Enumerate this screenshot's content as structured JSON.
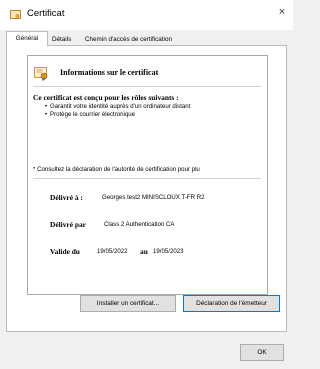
{
  "window": {
    "title": "Certificat",
    "close_glyph": "×"
  },
  "tabs": [
    {
      "label": "Général",
      "active": true
    },
    {
      "label": "Détails",
      "active": false
    },
    {
      "label": "Chemin d'accès de certification",
      "active": false
    }
  ],
  "info": {
    "title": "Informations sur le certificat",
    "purpose_heading": "Ce certificat est conçu pour les rôles suivants :",
    "purposes": [
      "Garantit votre identité auprès d'un ordinateur distant",
      "Protège le courrier électronique"
    ],
    "note": "* Consultez la déclaration de l'autorité de certification pour plu",
    "issued_to_label": "Délivré à :",
    "issued_to_value": "Georges test2 MINISCLOUX T-FR R2",
    "issued_by_label": "Délivré par",
    "issued_by_value": "Class 2 Authentication CA",
    "valid_from_label": "Valide du",
    "valid_from_value": "19/05/2022",
    "valid_to_label": "au",
    "valid_to_value": "19/05/2023"
  },
  "buttons": {
    "install": "Installer un certificat...",
    "declaration": "Déclaration de l'émetteur",
    "ok": "OK"
  },
  "icons": {
    "app": "certificate-icon",
    "info": "certificate-ribbon-icon",
    "close": "close-icon"
  },
  "colors": {
    "accent": "#0078d7",
    "button_bg": "#e1e1e1",
    "panel_bg": "#ffffff",
    "window_bg": "#f0f0f0"
  }
}
